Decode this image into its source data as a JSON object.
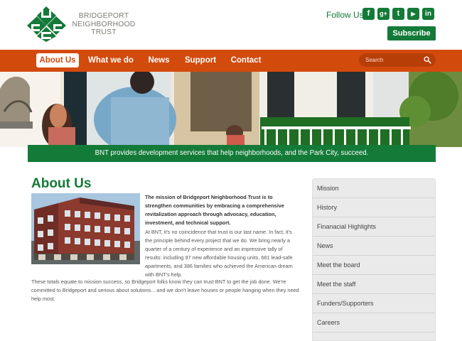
{
  "logo": {
    "text": "Bridgeport\nNeighborhood\nTrust"
  },
  "header": {
    "follow_label": "Follow Us",
    "social_icons": [
      "facebook",
      "google-plus",
      "twitter",
      "youtube",
      "linkedin"
    ],
    "subscribe_label": "Subscribe"
  },
  "nav": {
    "items": [
      {
        "label": "About Us",
        "active": true
      },
      {
        "label": "What we do",
        "active": false
      },
      {
        "label": "News",
        "active": false
      },
      {
        "label": "Support",
        "active": false
      },
      {
        "label": "Contact",
        "active": false
      }
    ],
    "search_placeholder": "Search"
  },
  "banner": {
    "text": "BNT provides development services that help neighborhoods, and the Park City, succeed."
  },
  "main": {
    "title": "About Us",
    "intro": "The mission of Bridgeport Neighborhood Trust is to strengthen communities by embracing a comprehensive revitalization approach through advocacy, education, investment, and technical support.",
    "para2": "At BNT, it's no coincidence that trust is our last name. In fact, it's the principle behind every project that we do. We bring nearly a quarter of a century of experience and an impressive tally of results: including 97 new affordable housing units, 681 lead-safe apartments, and 386 families who achieved the American dream with BNT's help.",
    "para3": "These totals equate to mission success, so Bridgeport folks know they can trust BNT to get the job done. We're committed to Bridgeport and serious about solutions... and we don't leave houses or people hanging when they need help most."
  },
  "sidebar": {
    "items": [
      "Mission",
      "History",
      "Finanacial Highlights",
      "News",
      "Meet the board",
      "Meet the staff",
      "Funders/Supporters",
      "Careers"
    ]
  },
  "colors": {
    "green": "#137a38",
    "orange": "#d34a0d",
    "dark_orange": "#b83e08",
    "gray": "#eaeaea"
  }
}
